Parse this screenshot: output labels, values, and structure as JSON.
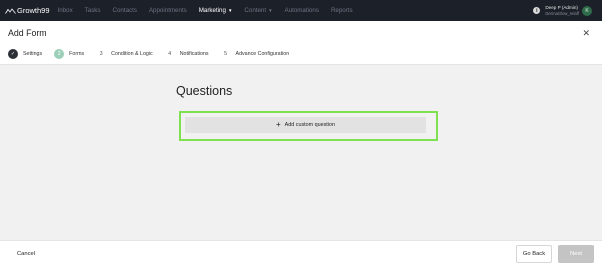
{
  "app": {
    "brand": "Growth99",
    "nav": [
      {
        "label": "Inbox",
        "active": false
      },
      {
        "label": "Tasks",
        "active": false
      },
      {
        "label": "Contacts",
        "active": false
      },
      {
        "label": "Appointments",
        "active": false
      },
      {
        "label": "Marketing",
        "active": true,
        "has_caret": true
      },
      {
        "label": "Content",
        "active": false,
        "has_caret": true
      },
      {
        "label": "Automations",
        "active": false
      },
      {
        "label": "Reports",
        "active": false
      }
    ],
    "user": {
      "name": "Deep P (Admin)",
      "org": "DermaGlow_relaff",
      "initial": "K"
    },
    "info_glyph": "i"
  },
  "form": {
    "title": "Add Form",
    "close_glyph": "✕",
    "steps": [
      {
        "num": "✓",
        "label": "Settings",
        "state": "done"
      },
      {
        "num": "2",
        "label": "Forms",
        "state": "current"
      },
      {
        "num": "3",
        "label": "Condition & Logic",
        "state": "todo"
      },
      {
        "num": "4",
        "label": "Notifications",
        "state": "todo"
      },
      {
        "num": "5",
        "label": "Advance Configuration",
        "state": "todo"
      }
    ]
  },
  "main": {
    "heading": "Questions",
    "add_button": {
      "plus": "+",
      "label": "Add custom question"
    }
  },
  "footer": {
    "cancel": "Cancel",
    "go_back": "Go Back",
    "next": "Next"
  },
  "colors": {
    "nav_bg": "#1b2029",
    "highlight": "#7fe050",
    "current_step": "#9ccfb7",
    "next_disabled": "#c4c4c4"
  }
}
